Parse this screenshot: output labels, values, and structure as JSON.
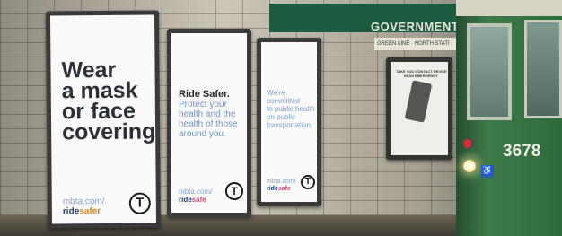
{
  "station": {
    "name": "GOVERNMENT CENT",
    "line": "GREEN LINE · NORTH STATI"
  },
  "posters": [
    {
      "headline_lines": [
        "Wear",
        "a mask",
        "or face",
        "covering."
      ],
      "url_line1": "mbta.com/",
      "url_ride": "ride",
      "url_suffix": "safer",
      "logo": "T"
    },
    {
      "bold_line": "Ride Safer.",
      "body_lines": [
        "Protect your",
        "health and the",
        "health of those",
        "around you."
      ],
      "url_line1": "mbta.com/",
      "url_ride": "ride",
      "url_suffix": "safe",
      "logo": "T"
    },
    {
      "body_lines": [
        "We're",
        "committed",
        "to public health",
        "on public",
        "transportation."
      ],
      "url_line1": "mbta.com/",
      "url_ride": "ride",
      "url_suffix": "safe",
      "logo": "T"
    },
    {
      "headline_lines": [
        "TAKE YOU CONTACT DEVICE HELPS",
        "IN AN EMERGENCY"
      ]
    }
  ],
  "train": {
    "number": "3678",
    "accessibility_icon": "wheelchair-icon"
  },
  "colors": {
    "station_band": "#1c5b3f",
    "accent_orange": "#e08a1f",
    "accent_pink": "#d24a7a",
    "ride_blue": "#1f3f7a"
  }
}
